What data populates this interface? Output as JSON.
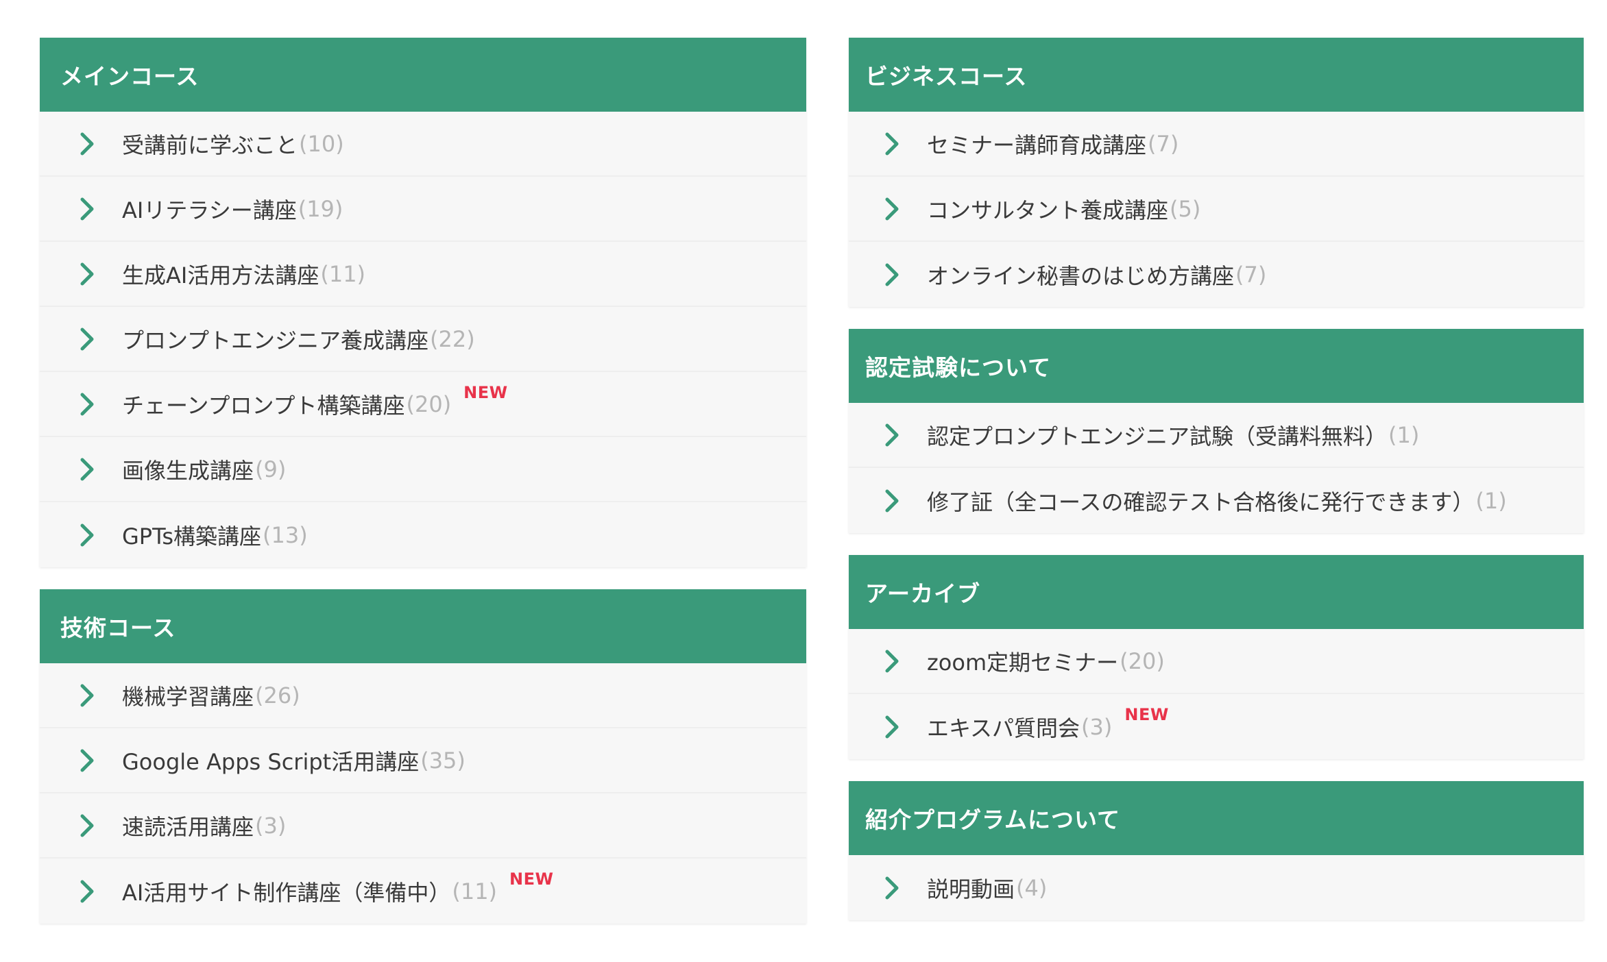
{
  "colors": {
    "header_bg": "#3a9a7a",
    "chevron": "#3a9a7a",
    "new_badge": "#e8334a"
  },
  "icons": {
    "list_item": "chevron-right-icon"
  },
  "left": {
    "main_course": {
      "title": "メインコース",
      "items": [
        {
          "label": "受講前に学ぶこと",
          "count": "(10)",
          "badge": ""
        },
        {
          "label": "AIリテラシー講座",
          "count": "(19)",
          "badge": ""
        },
        {
          "label": "生成AI活用方法講座",
          "count": "(11)",
          "badge": ""
        },
        {
          "label": "プロンプトエンジニア養成講座",
          "count": "(22)",
          "badge": ""
        },
        {
          "label": "チェーンプロンプト構築講座",
          "count": "(20)",
          "badge": "NEW"
        },
        {
          "label": "画像生成講座",
          "count": "(9)",
          "badge": ""
        },
        {
          "label": "GPTs構築講座",
          "count": "(13)",
          "badge": ""
        }
      ]
    },
    "tech_course": {
      "title": "技術コース",
      "items": [
        {
          "label": "機械学習講座",
          "count": "(26)",
          "badge": ""
        },
        {
          "label": "Google Apps Script活用講座",
          "count": "(35)",
          "badge": ""
        },
        {
          "label": "速読活用講座",
          "count": "(3)",
          "badge": ""
        },
        {
          "label": "AI活用サイト制作講座（準備中）",
          "count": "(11)",
          "badge": "NEW"
        }
      ]
    }
  },
  "right": {
    "business_course": {
      "title": "ビジネスコース",
      "items": [
        {
          "label": "セミナー講師育成講座",
          "count": "(7)",
          "badge": ""
        },
        {
          "label": "コンサルタント養成講座",
          "count": "(5)",
          "badge": ""
        },
        {
          "label": "オンライン秘書のはじめ方講座",
          "count": "(7)",
          "badge": ""
        }
      ]
    },
    "certification": {
      "title": "認定試験について",
      "items": [
        {
          "label": "認定プロンプトエンジニア試験（受講料無料）",
          "count": "(1)",
          "badge": ""
        },
        {
          "label": "修了証（全コースの確認テスト合格後に発行できます）",
          "count": "(1)",
          "badge": ""
        }
      ]
    },
    "archive": {
      "title": "アーカイブ",
      "items": [
        {
          "label": "zoom定期セミナー",
          "count": "(20)",
          "badge": ""
        },
        {
          "label": "エキスパ質問会",
          "count": "(3)",
          "badge": "NEW"
        }
      ]
    },
    "referral": {
      "title": "紹介プログラムについて",
      "items": [
        {
          "label": "説明動画",
          "count": "(4)",
          "badge": ""
        }
      ]
    }
  }
}
